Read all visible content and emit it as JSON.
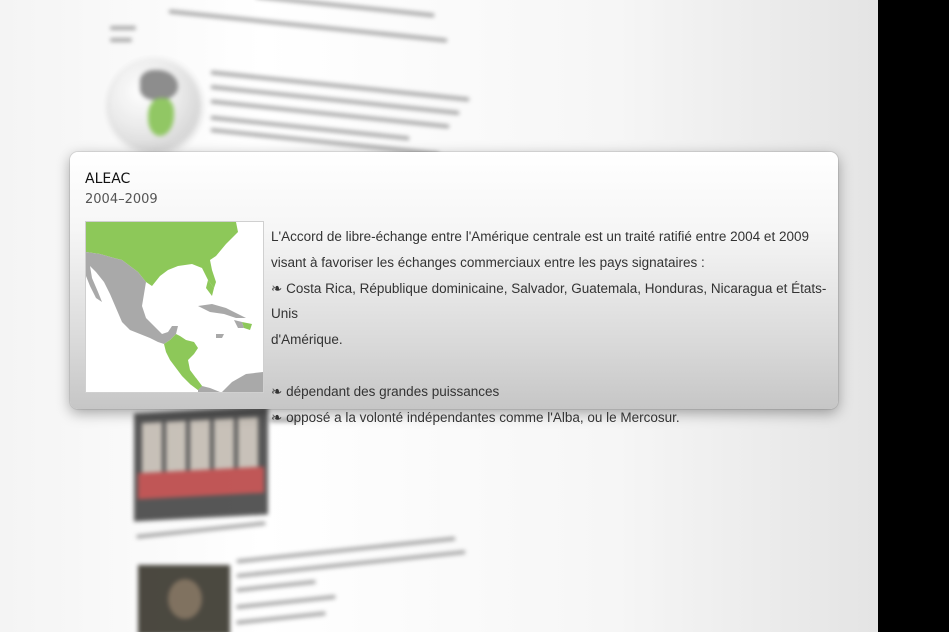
{
  "popup": {
    "title": "ALEAC",
    "years": "2004–2009",
    "map_icon": "central-america-map",
    "map_colors": {
      "highlight": "#8dc859",
      "land": "#a9a9a9",
      "water": "#ffffff"
    },
    "description": {
      "line1": "L'Accord de libre-échange entre l'Amérique centrale est un traité ratifié entre 2004 et 2009",
      "line2": "visant à favoriser les échanges commerciaux entre les pays signataires :",
      "bullet_glyph": "❧",
      "member_list": "Costa Rica, République dominicaine, Salvador, Guatemala, Honduras, Nicaragua et États-Unis",
      "member_list_cont": "d'Amérique.",
      "point1": "dépendant des grandes puissances",
      "point2": "opposé a la volonté indépendantes comme l'Alba, ou le Mercosur."
    }
  }
}
